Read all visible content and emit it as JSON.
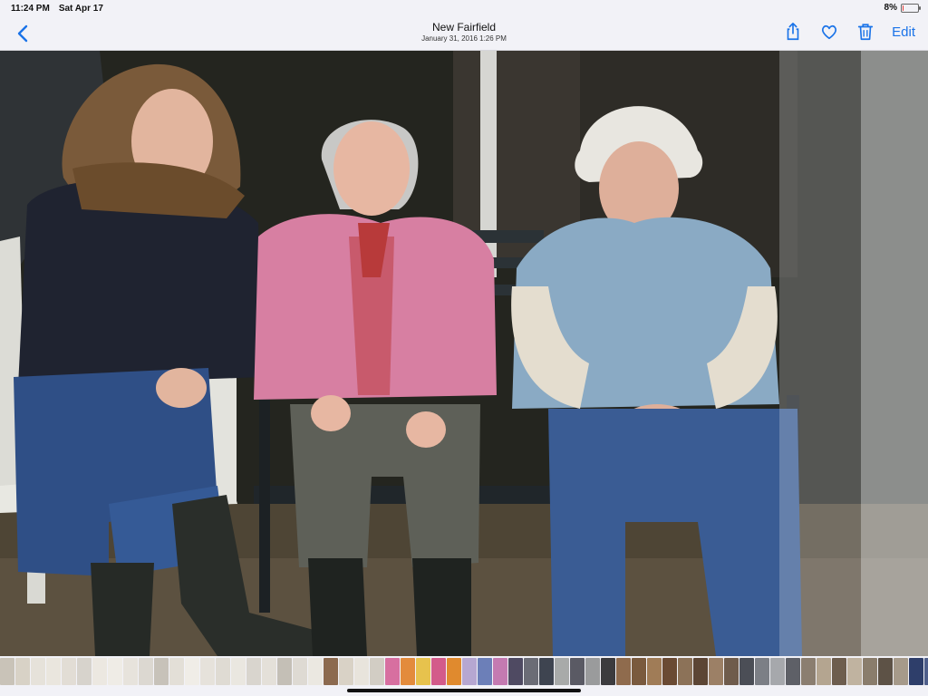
{
  "status_bar": {
    "time": "11:24 PM",
    "date": "Sat Apr 17",
    "battery_percent": "8%",
    "battery_level": 0.08,
    "battery_color": "#e53935"
  },
  "nav": {
    "title": "New Fairfield",
    "subtitle": "January 31, 2016  1:26 PM",
    "edit_label": "Edit",
    "accent": "#1a73e8",
    "icons": [
      "chevron-left-icon",
      "share-icon",
      "heart-icon",
      "trash-icon"
    ]
  },
  "photo": {
    "subject": "photo-three-people-on-bench"
  },
  "film_strip": {
    "thumb_colors": [
      "#c9c3b8",
      "#d8d2c6",
      "#e6e2da",
      "#eae6de",
      "#e2ddd5",
      "#d7d3cc",
      "#ece8e1",
      "#efece6",
      "#e7e3dc",
      "#dcd8d1",
      "#c7c2b9",
      "#e3dfd7",
      "#f0ede7",
      "#e6e2db",
      "#dfdbd3",
      "#eae7e0",
      "#d9d5ce",
      "#e4e0d9",
      "#c4bfb6",
      "#dedad3",
      "#ebe8e1",
      "#8c6a4f",
      "#d9d2c6",
      "#e8e4dc",
      "#d2cdc4",
      "#d76fa0",
      "#e38b3c",
      "#e7c24d",
      "#d35b8a",
      "#e08a2e",
      "#b6a7d1",
      "#6c7fb8",
      "#c47ab1",
      "#4f4a62",
      "#6b6c76",
      "#3e4450",
      "#a8aaa9",
      "#5a5a64",
      "#9a9b9c",
      "#3c3b3e",
      "#8f6b4d",
      "#7a5a3e",
      "#a07c57",
      "#6a4a33",
      "#8c7258",
      "#5c4534",
      "#9c8066",
      "#6f5c4c",
      "#4b4e56",
      "#7c7f86",
      "#a6a8ac",
      "#5e6067",
      "#8b7e70",
      "#b4a590",
      "#6d5d4e",
      "#c0b3a0",
      "#8a7d6c",
      "#5d5246",
      "#a69a8a",
      "#2e3e6a",
      "#4e5e8a",
      "#7a8ab0",
      "#b38c53",
      "#8c6b3f",
      "#d6b985"
    ]
  }
}
